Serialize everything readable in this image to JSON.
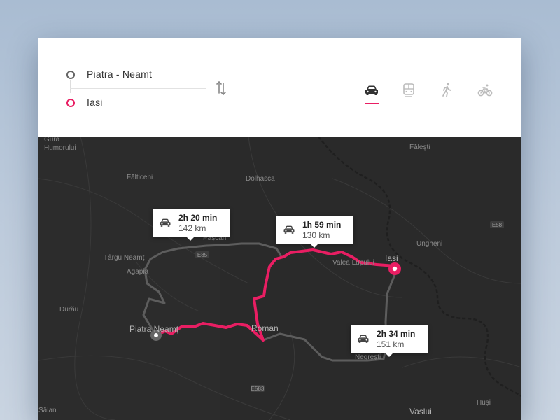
{
  "route": {
    "origin": "Piatra - Neamt",
    "destination": "Iasi"
  },
  "travel_modes": [
    {
      "name": "car",
      "icon": "car-icon",
      "selected": true
    },
    {
      "name": "transit",
      "icon": "train-icon",
      "selected": false
    },
    {
      "name": "walk",
      "icon": "walk-icon",
      "selected": false
    },
    {
      "name": "bike",
      "icon": "bike-icon",
      "selected": false
    }
  ],
  "colors": {
    "accent": "#e91e63",
    "map_background": "#2a2a2a",
    "alt_route": "#6a6a6a"
  },
  "routes": [
    {
      "time": "2h 20 min",
      "distance": "142 km"
    },
    {
      "time": "1h 59 min",
      "distance": "130 km"
    },
    {
      "time": "2h 34 min",
      "distance": "151 km"
    }
  ],
  "map_labels": {
    "gura_humorului": "Gura\nHumorului",
    "falticeni": "Fălticeni",
    "dolhasca": "Dolhasca",
    "falesti": "Fălești",
    "targu_neamt": "Târgu Neamț",
    "agapia": "Agapia",
    "pascani": "Pașcani",
    "valea_lupului": "Valea Lupului",
    "iasi": "Iasi",
    "ungheni": "Ungheni",
    "durau": "Durău",
    "piatra_neamt": "Piatra Neamț",
    "roman": "Roman",
    "negresti": "Negrești",
    "vaslui": "Vaslui",
    "husi": "Huși",
    "salan": "Sălan",
    "e58": "E58",
    "e85": "E85",
    "e583": "E583"
  }
}
